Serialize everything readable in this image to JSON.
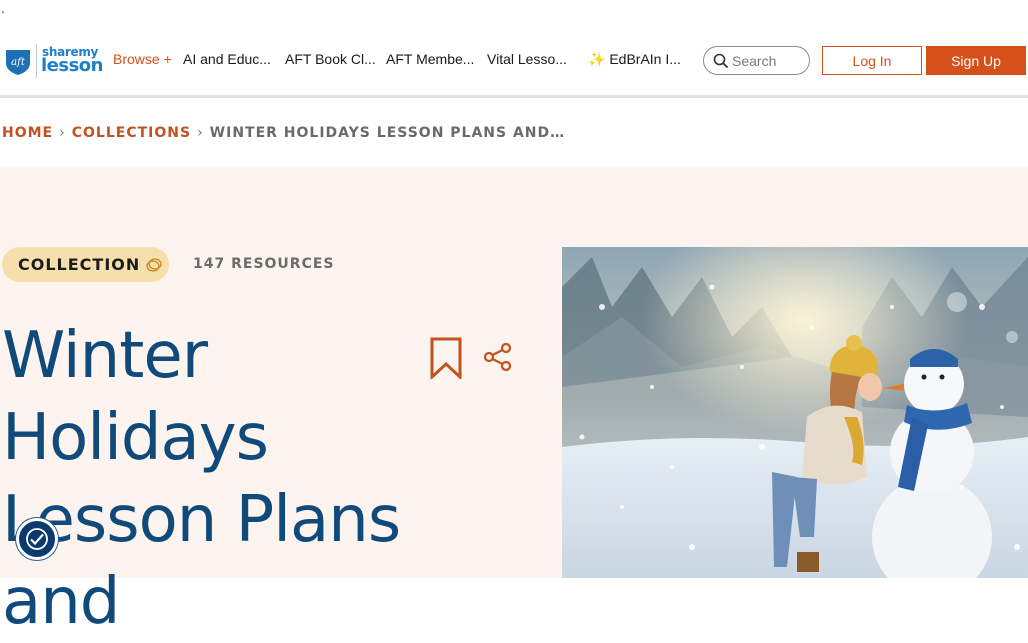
{
  "top_dot": ".",
  "logo": {
    "line1": "sharemy",
    "line2": "lesson",
    "mark": "aft-logo-icon"
  },
  "nav": {
    "browse": "Browse +",
    "items": [
      "AI and Educ...",
      "AFT Book Cl...",
      "AFT Membe...",
      "Vital Lesso...",
      "✨ EdBrAIn I..."
    ]
  },
  "search": {
    "placeholder": "Search",
    "icon": "search-icon"
  },
  "auth": {
    "login": "Log In",
    "signup": "Sign Up"
  },
  "breadcrumb": {
    "home": "HOME",
    "collections": "COLLECTIONS",
    "current": "WINTER HOLIDAYS LESSON PLANS AND…",
    "separator": "›"
  },
  "hero": {
    "badge": "COLLECTION",
    "badge_icon": "rings-icon",
    "resources": "147 RESOURCES",
    "title": "Winter Holidays Lesson Plans and",
    "bookmark_icon": "bookmark-icon",
    "share_icon": "share-icon",
    "image": "girl-kissing-snowman-photo"
  },
  "colors": {
    "accent": "#d5501a",
    "title": "#0f4a7a",
    "hero_bg": "#fdf4ef",
    "badge_bg": "#f5dfac"
  },
  "accessibility": {
    "icon": "accessibility-check-icon"
  }
}
